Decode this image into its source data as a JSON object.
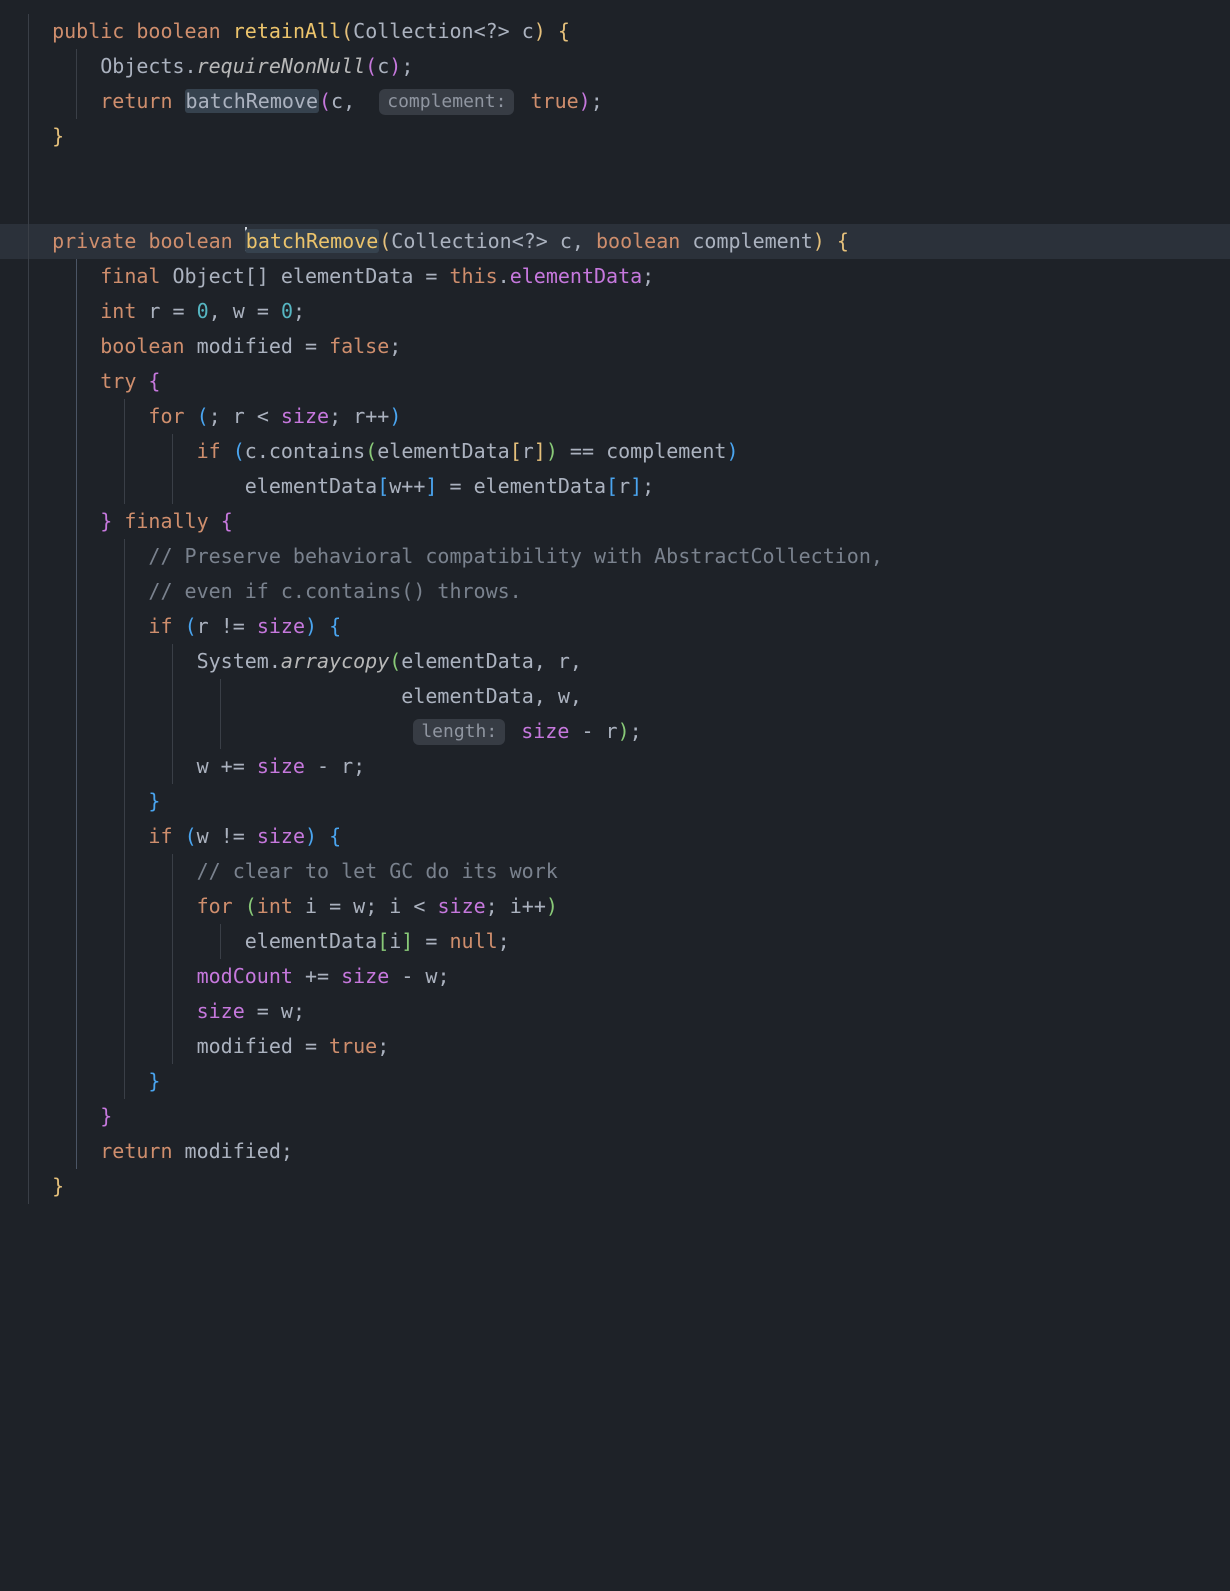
{
  "tokens": {
    "kw_public": "public",
    "kw_private": "private",
    "kw_boolean": "boolean",
    "kw_return": "return",
    "kw_final": "final",
    "kw_int": "int",
    "kw_try": "try",
    "kw_for": "for",
    "kw_if": "if",
    "kw_finally": "finally",
    "kw_this": "this",
    "kw_null": "null",
    "kw_true": "true",
    "kw_false": "false"
  },
  "types": {
    "Collection": "Collection",
    "Object": "Object",
    "Objects": "Objects",
    "System": "System"
  },
  "methods": {
    "retainAll": "retainAll",
    "batchRemove": "batchRemove",
    "requireNonNull": "requireNonNull",
    "contains": "contains",
    "arraycopy": "arraycopy"
  },
  "idents": {
    "c": "c",
    "r": "r",
    "w": "w",
    "i": "i",
    "size": "size",
    "elementData": "elementData",
    "modified": "modified",
    "complement": "complement",
    "modCount": "modCount"
  },
  "nums": {
    "zero": "0"
  },
  "hints": {
    "complement": "complement:",
    "length": "length:"
  },
  "comments": {
    "c1": "// Preserve behavioral compatibility with AbstractCollection,",
    "c2": "// even if c.contains() throws.",
    "c3": "// clear to let GC do its work"
  },
  "punct": {
    "wildcard": "<?>",
    "arr": "[]"
  }
}
